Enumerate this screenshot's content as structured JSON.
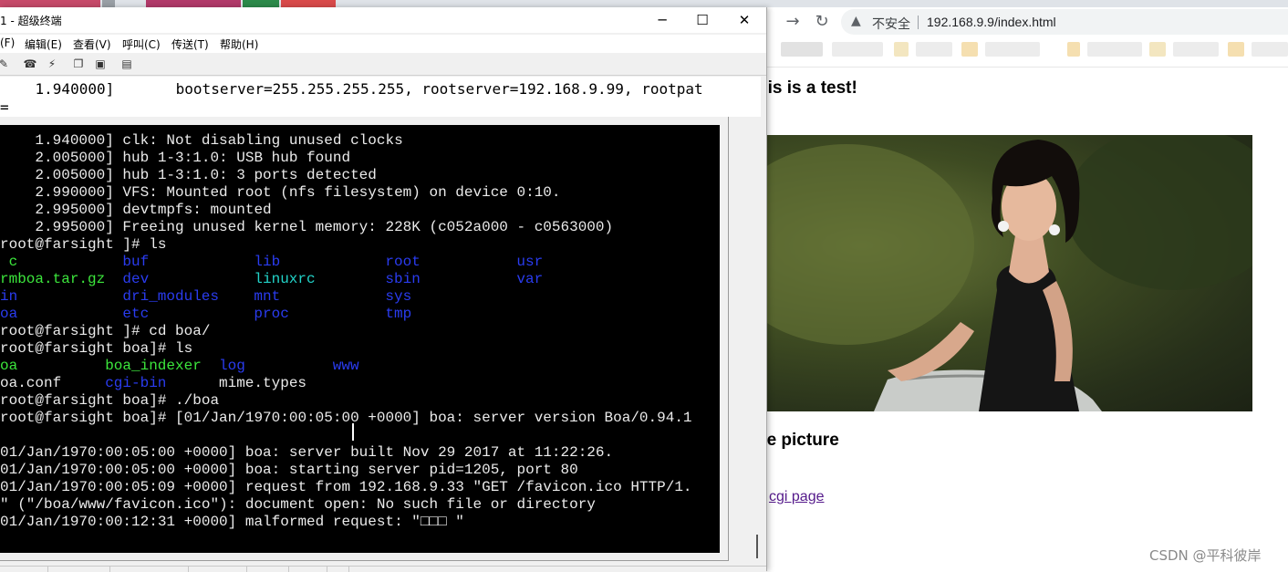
{
  "browser": {
    "address": {
      "warning_icon": "warning-triangle-icon",
      "insecure_label": "不安全",
      "url": "192.168.9.9/index.html"
    },
    "nav_icons": [
      "back-arrow-icon",
      "forward-arrow-icon",
      "reload-icon"
    ],
    "page": {
      "heading": "his is a test!",
      "subheading": "ee picture",
      "link_text": "cgi page"
    },
    "watermark": "CSDN @平科彼岸"
  },
  "terminal": {
    "window_title": "1 - 超级终端",
    "menu": [
      "(F)",
      "编辑(E)",
      "查看(V)",
      "呼叫(C)",
      "传送(T)",
      "帮助(H)"
    ],
    "toolbar_icons": [
      "new-connection-icon",
      "open-icon",
      "phone-icon",
      "disconnect-icon",
      "send-icon",
      "receive-icon",
      "properties-icon"
    ],
    "scrollback": [
      "    1.940000]       bootserver=255.255.255.255, rootserver=192.168.9.99, rootpat",
      "="
    ],
    "lines": [
      [
        {
          "t": "    1.940000] clk: Not disabling unused clocks",
          "c": "w",
          "col": 0
        }
      ],
      [
        {
          "t": "    2.005000] hub 1-3:1.0: USB hub found",
          "c": "w",
          "col": 0
        }
      ],
      [
        {
          "t": "    2.005000] hub 1-3:1.0: 3 ports detected",
          "c": "w",
          "col": 0
        }
      ],
      [
        {
          "t": "    2.990000] VFS: Mounted root (nfs filesystem) on device 0:10.",
          "c": "w",
          "col": 0
        }
      ],
      [
        {
          "t": "    2.995000] devtmpfs: mounted",
          "c": "w",
          "col": 0
        }
      ],
      [
        {
          "t": "    2.995000] Freeing unused kernel memory: 228K (c052a000 - c0563000)",
          "c": "w",
          "col": 0
        }
      ],
      [
        {
          "t": "root@farsight ]# ls",
          "c": "w",
          "col": 0
        }
      ],
      [
        {
          "t": " c",
          "c": "g",
          "col": 0
        },
        {
          "t": "buf",
          "c": "b",
          "col": 14
        },
        {
          "t": "lib",
          "c": "b",
          "col": 29
        },
        {
          "t": "root",
          "c": "b",
          "col": 44
        },
        {
          "t": "usr",
          "c": "b",
          "col": 59
        }
      ],
      [
        {
          "t": "rmboa.tar.gz",
          "c": "g",
          "col": 0
        },
        {
          "t": "dev",
          "c": "b",
          "col": 14
        },
        {
          "t": "linuxrc",
          "c": "c",
          "col": 29
        },
        {
          "t": "sbin",
          "c": "b",
          "col": 44
        },
        {
          "t": "var",
          "c": "b",
          "col": 59
        }
      ],
      [
        {
          "t": "in",
          "c": "b",
          "col": 0
        },
        {
          "t": "dri_modules",
          "c": "b",
          "col": 14
        },
        {
          "t": "mnt",
          "c": "b",
          "col": 29
        },
        {
          "t": "sys",
          "c": "b",
          "col": 44
        }
      ],
      [
        {
          "t": "oa",
          "c": "b",
          "col": 0
        },
        {
          "t": "etc",
          "c": "b",
          "col": 14
        },
        {
          "t": "proc",
          "c": "b",
          "col": 29
        },
        {
          "t": "tmp",
          "c": "b",
          "col": 44
        }
      ],
      [
        {
          "t": "root@farsight ]# cd boa/",
          "c": "w",
          "col": 0
        }
      ],
      [
        {
          "t": "root@farsight boa]# ls",
          "c": "w",
          "col": 0
        }
      ],
      [
        {
          "t": "oa",
          "c": "g",
          "col": 0
        },
        {
          "t": "boa_indexer",
          "c": "g",
          "col": 12
        },
        {
          "t": "log",
          "c": "b",
          "col": 25
        },
        {
          "t": "www",
          "c": "b",
          "col": 38
        }
      ],
      [
        {
          "t": "oa.conf",
          "c": "w",
          "col": 0
        },
        {
          "t": "cgi-bin",
          "c": "b",
          "col": 12
        },
        {
          "t": "mime.types",
          "c": "w",
          "col": 25
        }
      ],
      [
        {
          "t": "root@farsight boa]# ./boa",
          "c": "w",
          "col": 0
        }
      ],
      [
        {
          "t": "root@farsight boa]# [01/Jan/1970:00:05:00 +0000] boa: server version Boa/0.94.1",
          "c": "w",
          "col": 0
        }
      ],
      [
        {
          "t": "",
          "c": "w",
          "col": 0
        }
      ],
      [
        {
          "t": "01/Jan/1970:00:05:00 +0000] boa: server built Nov 29 2017 at 11:22:26.",
          "c": "w",
          "col": 0
        }
      ],
      [
        {
          "t": "01/Jan/1970:00:05:00 +0000] boa: starting server pid=1205, port 80",
          "c": "w",
          "col": 0
        }
      ],
      [
        {
          "t": "01/Jan/1970:00:05:09 +0000] request from 192.168.9.33 \"GET /favicon.ico HTTP/1.",
          "c": "w",
          "col": 0
        }
      ],
      [
        {
          "t": "\" (\"/boa/www/favicon.ico\"): document open: No such file or directory",
          "c": "w",
          "col": 0
        }
      ],
      [
        {
          "t": "01/Jan/1970:00:12:31 +0000] malformed request: \"□□□ \"",
          "c": "w",
          "col": 0
        }
      ]
    ]
  },
  "colors": {
    "term_bg": "#000000",
    "term_fg": "#ebebeb",
    "term_blue": "#2a3cf0",
    "term_green": "#3ce63c",
    "term_cyan": "#22d3c8",
    "link_visited": "#551a8b"
  }
}
